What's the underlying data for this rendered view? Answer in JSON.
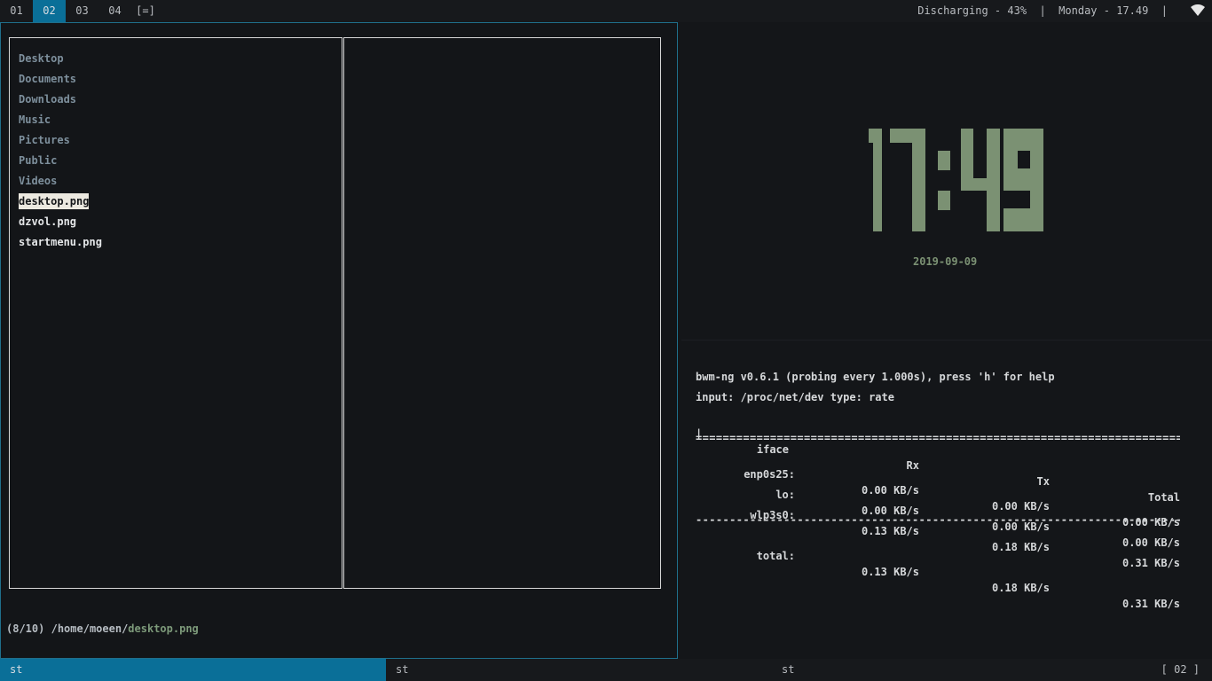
{
  "topbar": {
    "tags": [
      "01",
      "02",
      "03",
      "04"
    ],
    "active_tag": "02",
    "layout": "[=]",
    "status": "Discharging - 43%  |  Monday - 17.49  |"
  },
  "file_manager": {
    "items": [
      {
        "name": "Desktop",
        "type": "dir"
      },
      {
        "name": "Documents",
        "type": "dir"
      },
      {
        "name": "Downloads",
        "type": "dir"
      },
      {
        "name": "Music",
        "type": "dir"
      },
      {
        "name": "Pictures",
        "type": "dir"
      },
      {
        "name": "Public",
        "type": "dir"
      },
      {
        "name": "Videos",
        "type": "dir"
      },
      {
        "name": "desktop.png",
        "type": "file"
      },
      {
        "name": "dzvol.png",
        "type": "file"
      },
      {
        "name": "startmenu.png",
        "type": "file"
      }
    ],
    "selected": "desktop.png",
    "status_position": "(8/10)",
    "status_path": "/home/moeen/",
    "status_file": "desktop.png"
  },
  "clock": {
    "time": "17:49",
    "date": "2019-09-09",
    "color": "#7b9173"
  },
  "bwm": {
    "header": "bwm-ng v0.6.1 (probing every 1.000s), press 'h' for help",
    "input": "input: /proc/net/dev type: rate",
    "columns": {
      "bar": "|",
      "iface": "iface",
      "rx": "Rx",
      "tx": "Tx",
      "total": "Total"
    },
    "separator_double": "============================================================================",
    "separator_single": "----------------------------------------------------------------------------",
    "rows": [
      {
        "iface": "enp0s25:",
        "rx": "0.00 KB/s",
        "tx": "0.00 KB/s",
        "total": "0.00 KB/s"
      },
      {
        "iface": "lo:",
        "rx": "0.00 KB/s",
        "tx": "0.00 KB/s",
        "total": "0.00 KB/s"
      },
      {
        "iface": "wlp3s0:",
        "rx": "0.13 KB/s",
        "tx": "0.18 KB/s",
        "total": "0.31 KB/s"
      }
    ],
    "total": {
      "iface": "total:",
      "rx": "0.13 KB/s",
      "tx": "0.18 KB/s",
      "total": "0.31 KB/s"
    }
  },
  "bottombar": {
    "tasks": [
      "st",
      "st",
      "st"
    ],
    "active_task": 0,
    "indicator": "[ 02 ]"
  },
  "colors": {
    "accent": "#0a6f98",
    "background": "#141619",
    "dir": "#7d8f9c",
    "clock": "#7b9173"
  }
}
